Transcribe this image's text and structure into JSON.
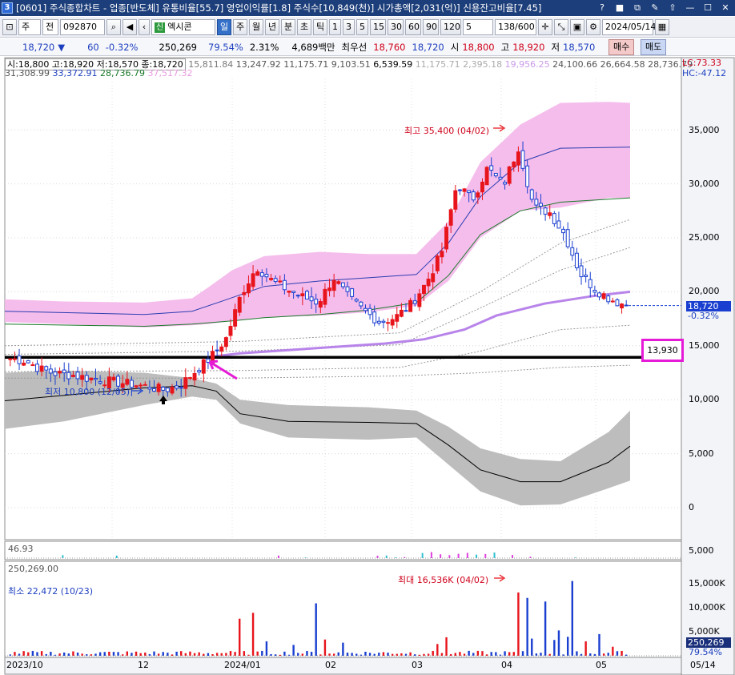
{
  "window": {
    "number": "3",
    "title": "[0601] 주식종합차트 - 업종[반도체] 유통비율[55.7] 영업이익률[1.8] 주식수[10,849(천)] 시가총액[2,031(억)] 신용잔고비율[7.45]",
    "buttons": [
      "?",
      "■",
      "⧉",
      "✎",
      "⇧",
      "—",
      "☐",
      "✕"
    ]
  },
  "toolbar": {
    "market": "주",
    "code_type": "전",
    "code": "092870",
    "badge": "신",
    "stock_name": "엑시콘",
    "periods": [
      "일",
      "주",
      "월",
      "년",
      "분",
      "초",
      "틱"
    ],
    "active_period": "일",
    "minutes": [
      "1",
      "3",
      "5",
      "15",
      "30",
      "60",
      "90",
      "120"
    ],
    "interval": "5",
    "count": "138",
    "count_total": "/600",
    "date": "2024/05/14",
    "buy": "매수",
    "sell": "매도"
  },
  "quote": {
    "price": "18,720",
    "arrow": "▼",
    "change": "60",
    "change_pct": "-0.32%",
    "volume": "250,269",
    "vol_ratio": "79.54%",
    "turnover": "2.31%",
    "amount": "4,689백만",
    "best_label": "최우선",
    "best_ask": "18,760",
    "best_bid": "18,720",
    "open_label": "시",
    "open": "18,800",
    "high_label": "고",
    "high": "18,920",
    "low_label": "저",
    "low": "18,570"
  },
  "legend": {
    "ohlc": "시:18,800 고:18,920 저:18,570 종:18,720",
    "ma_a": "15,811.84",
    "ma_b": "13,247.92",
    "ma_c": "11,175.71",
    "ma_d": "9,103.51",
    "ma_e": "6,539.59",
    "ma_f": "11,175.71",
    "ma_g": "2,395.18",
    "ma_h": "19,956.25",
    "ma_i": "24,100.66",
    "ma_j": "26,664.58",
    "ma_k": "28,736.79",
    "ma_l": "31,308.99",
    "ma_m": "33,372.91",
    "ma_n": "28,736.79",
    "ma_o": "37,517.32",
    "lc": "LC:73.33",
    "hc": "HC:-47.12"
  },
  "colors": {
    "up": "#e8141c",
    "down": "#1a3fd0",
    "band_pink": "#f4b6ea",
    "band_gray": "#bdbdbd",
    "ma_purple": "#b884ea",
    "highlight": "#e51bd7"
  },
  "price_axis": [
    "35,000",
    "30,000",
    "25,000",
    "20,000",
    "15,000",
    "10,000",
    "5,000",
    "0"
  ],
  "price_tag": {
    "price": "18,720",
    "pct": "-0.32%"
  },
  "support_label": "13,930",
  "annotations": {
    "high": "최고 35,400 (04/02)",
    "low": "최저 10,800 (12/05)",
    "vol_max": "최대 16,536K (04/02)",
    "vol_min": "최소 22,472 (10/23)"
  },
  "sub_panel": {
    "label": "46.93",
    "axis": "5,000"
  },
  "volume_panel": {
    "label": "250,269.00",
    "axis": [
      "15,000K",
      "10,000K",
      "5,000K"
    ],
    "tag_volume": "250,269",
    "tag_pct": "79.54%"
  },
  "x_axis": [
    "2023/10",
    "12",
    "2024/01",
    "02",
    "03",
    "04",
    "05"
  ],
  "x_date": "05/14",
  "chart_data": {
    "type": "candlestick",
    "title": "",
    "ylim": [
      0,
      38000
    ],
    "annotated_high": 35400,
    "annotated_low": 10800,
    "support_line": 13930,
    "last_close": 18720,
    "closes_approx": [
      13800,
      13600,
      12800,
      12400,
      12300,
      12000,
      11800,
      11600,
      11400,
      11200,
      10900,
      11300,
      12600,
      13900,
      15600,
      19800,
      22300,
      21000,
      20200,
      19500,
      19000,
      21300,
      19400,
      18200,
      17200,
      17600,
      18800,
      20800,
      23600,
      30000,
      28500,
      31500,
      29800,
      33400,
      27800,
      27400,
      25300,
      21700,
      20200,
      19300,
      18720
    ]
  }
}
